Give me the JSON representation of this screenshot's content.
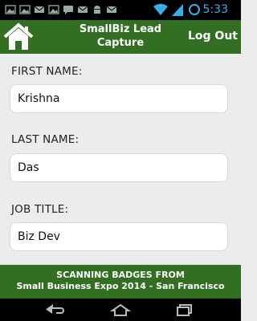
{
  "status_bar": {
    "time": "5:33",
    "notification_icons": [
      "image-icon",
      "image-icon",
      "mail-icon",
      "image-icon",
      "chat-icon",
      "mail-icon",
      "android-icon",
      "mail-icon"
    ],
    "system_icons": [
      "wifi-icon",
      "signal-icon",
      "sync-icon"
    ]
  },
  "header": {
    "title_line1": "SmallBiz Lead",
    "title_line2": "Capture",
    "logout_label": "Log Out",
    "home_icon": "home-icon"
  },
  "form": {
    "first_name_label": "FIRST NAME:",
    "first_name_value": "Krishna",
    "last_name_label": "LAST NAME:",
    "last_name_value": "Das",
    "job_title_label": "JOB TITLE:",
    "job_title_value": "Biz Dev"
  },
  "footer": {
    "line1": "SCANNING BADGES FROM",
    "line2": "Small Business Expo 2014 - San Francisco"
  },
  "nav_bar": {
    "icons": [
      "back-icon",
      "home-icon",
      "recent-apps-icon"
    ]
  },
  "colors": {
    "brand_green": "#326f22",
    "status_blue": "#39aee6"
  }
}
